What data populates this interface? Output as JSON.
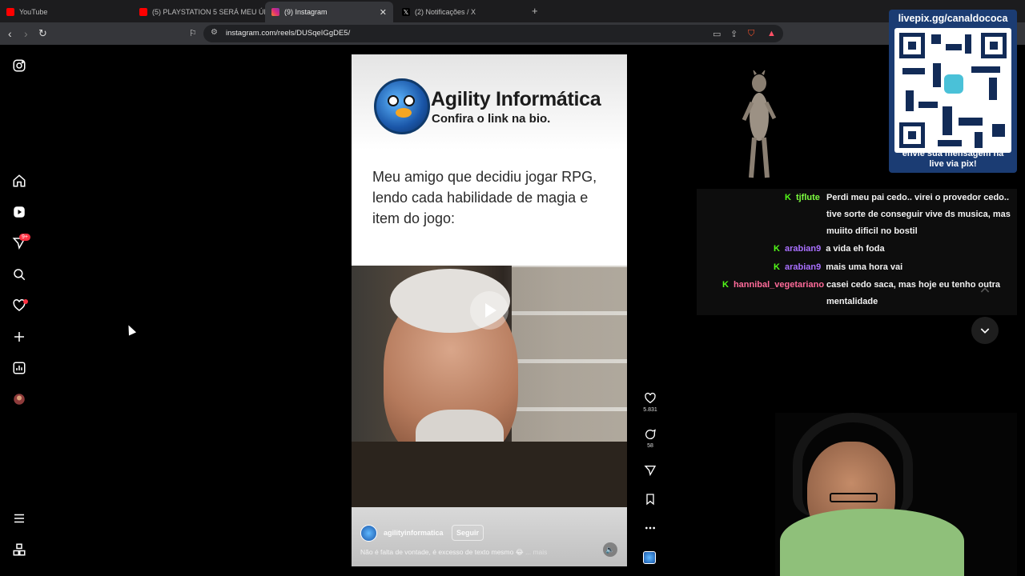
{
  "browser": {
    "tabs": [
      {
        "label": "YouTube",
        "favicon_color": "#ff0000"
      },
      {
        "label": "(5) PLAYSTATION 5 SERÁ MEU ÚLTIM",
        "favicon_color": "#ff0000"
      },
      {
        "label": "(9) Instagram",
        "favicon_color": "#e1306c",
        "active": true
      },
      {
        "label": "(2) Notificações / X",
        "favicon_color": "#ffffff"
      }
    ],
    "new_tab": "+",
    "url": "instagram.com/reels/DUSqeIGgDE5/"
  },
  "instagram": {
    "rail_icons": [
      "instagram-logo-icon",
      "home-icon",
      "reels-icon",
      "messages-icon",
      "search-icon",
      "notifications-icon",
      "create-icon",
      "dashboard-icon",
      "profile-avatar-icon",
      "menu-icon",
      "apps-icon"
    ],
    "messages_badge": "9+",
    "reel": {
      "brand_title": "Agility Informática",
      "brand_subtitle": "Confira o link na bio.",
      "caption": "Meu amigo que decidiu jogar RPG, lendo cada habilidade de magia e item do jogo:",
      "username": "agilityinformatica",
      "follow_label": "Seguir",
      "description": "Não é falta de vontade, é excesso de texto mesmo 😂",
      "more_label": "... mais"
    },
    "actions": {
      "likes": "5.831",
      "comments": "58"
    }
  },
  "stream_overlay": {
    "pix_title": "livepix.gg/canaldococa",
    "pix_footer_line1": "envie sua mensagem na",
    "pix_footer_line2": "live via pix!",
    "chat": [
      {
        "user": "tjflute",
        "user_color": "#7dfc40",
        "text_line1": "Perdi meu pai cedo.. virei o provedor cedo..",
        "text_line2": "tive sorte de conseguir vive ds musica, mas",
        "text_line3": "muiito dificil no bostil"
      },
      {
        "user": "arabian9",
        "user_color": "#a970ff",
        "text_line1": "a vida eh foda"
      },
      {
        "user": "arabian9",
        "user_color": "#a970ff",
        "text_line1": "mais uma hora vai"
      },
      {
        "user": "hannibal_vegetariano",
        "user_color": "#ff6b9a",
        "text_line1": "casei cedo saca, mas hoje eu tenho outra",
        "text_line2": "mentalidade"
      }
    ],
    "platform_glyph": "K"
  }
}
